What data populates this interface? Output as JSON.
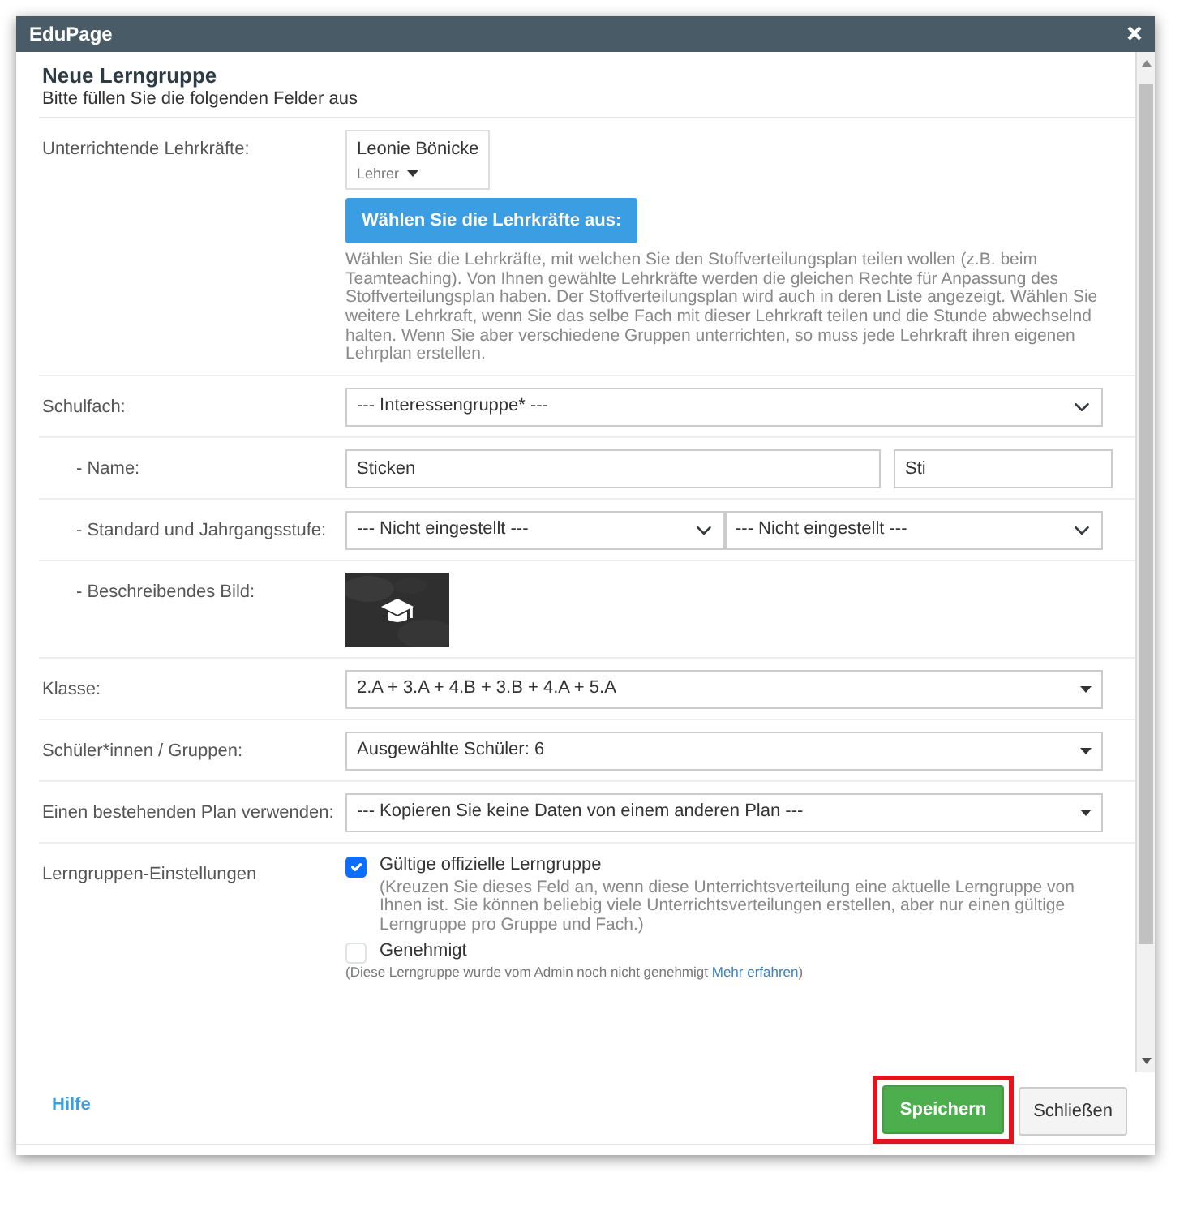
{
  "window": {
    "title": "EduPage"
  },
  "header": {
    "title": "Neue Lerngruppe",
    "subtitle": "Bitte füllen Sie die folgenden Felder aus"
  },
  "rows": [
    {
      "kind": "teachers",
      "label": "Unterrichtende Lehrkräfte:",
      "teacher": {
        "name": "Leonie Bönicke",
        "role": "Lehrer"
      },
      "button": "Wählen Sie die Lehrkräfte aus:",
      "help": "Wählen Sie die Lehrkräfte, mit welchen Sie den Stoffverteilungsplan teilen wollen (z.B. beim Teamteaching). Von Ihnen gewählte Lehrkräfte werden die gleichen Rechte für Anpassung des Stoffverteilungsplan haben. Der Stoffverteilungsplan wird auch in deren Liste angezeigt. Wählen Sie weitere Lehrkraft, wenn Sie das selbe Fach mit dieser Lehrkraft teilen und die Stunde abwechselnd halten. Wenn Sie aber verschiedene Gruppen unterrichten, so muss jede Lehrkraft ihren eigenen Lehrplan erstellen."
    },
    {
      "kind": "select",
      "label": "Schulfach:",
      "selects": [
        "--- Interessengruppe* ---"
      ],
      "children": [
        {
          "kind": "inputs",
          "label": "- Name:",
          "values": [
            "Sticken",
            "Sti"
          ]
        },
        {
          "kind": "select",
          "label": "- Standard und Jahrgangsstufe:",
          "selects": [
            "--- Nicht eingestellt ---",
            "--- Nicht eingestellt ---"
          ]
        },
        {
          "label": "- Beschreibendes Bild:"
        }
      ]
    },
    {
      "kind": "dropdown",
      "label": "Klasse:",
      "value": "2.A + 3.A + 4.B + 3.B + 4.A + 5.A"
    },
    {
      "kind": "dropdown",
      "label": "Schüler*innen / Gruppen:",
      "value": "Ausgewählte Schüler: 6"
    },
    {
      "kind": "dropdown",
      "label": "Einen bestehenden Plan verwenden:",
      "value": "--- Kopieren Sie keine Daten von einem anderen Plan ---"
    },
    {
      "kind": "settings",
      "label": "Lerngruppen-Einstellungen",
      "options": [
        {
          "label": "Gültige offizielle Lerngruppe",
          "checked": true,
          "note": "(Kreuzen Sie dieses Feld an, wenn diese Unterrichtsverteilung eine aktuelle Lerngruppe von Ihnen ist. Sie können beliebig viele Unterrichtsverteilungen erstellen, aber nur einen gültige Lerngruppe pro Gruppe und Fach.)"
        },
        {
          "label": "Genehmigt",
          "checked": false,
          "note": "(Diese Lerngruppe wurde vom Admin noch nicht genehmigt",
          "link": "Mehr erfahren",
          "note_end": ")"
        }
      ]
    }
  ],
  "footer": {
    "help": "Hilfe",
    "buttons": [
      {
        "label": "Speichern",
        "kind": "primary",
        "highlighted": true
      },
      {
        "label": "Schließen",
        "kind": "secondary",
        "highlighted": false
      }
    ]
  }
}
